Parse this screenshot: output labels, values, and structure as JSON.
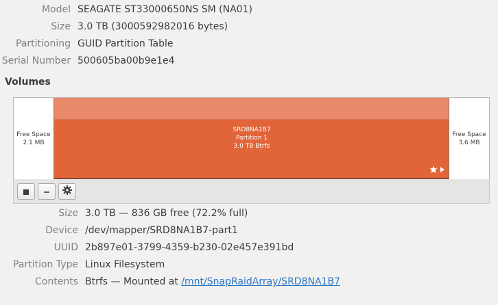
{
  "drive": {
    "model_label": "Model",
    "model_value": "SEAGATE ST33000650NS  SM (NA01)",
    "size_label": "Size",
    "size_value": "3.0 TB (3000592982016 bytes)",
    "partitioning_label": "Partitioning",
    "partitioning_value": "GUID Partition Table",
    "serial_label": "Serial Number",
    "serial_value": "500605ba00b9e1e4"
  },
  "volumes": {
    "title": "Volumes",
    "free_left": {
      "line1": "Free Space",
      "line2": "2.1 MB"
    },
    "free_right": {
      "line1": "Free Space",
      "line2": "3.6 MB"
    },
    "partition": {
      "name": "SRD8NA1B7",
      "number": "Partition 1",
      "summary": "3.0 TB Btrfs",
      "icons": [
        "star-icon",
        "play-icon"
      ]
    },
    "toolbar": {
      "buttons": [
        "stop-icon",
        "minus-icon",
        "gear-icon"
      ]
    }
  },
  "details": {
    "size_label": "Size",
    "size_value": "3.0 TB — 836 GB free (72.2% full)",
    "device_label": "Device",
    "device_value": "/dev/mapper/SRD8NA1B7-part1",
    "uuid_label": "UUID",
    "uuid_value": "2b897e01-3799-4359-b230-02e457e391bd",
    "ptype_label": "Partition Type",
    "ptype_value": "Linux Filesystem",
    "contents_label": "Contents",
    "contents_prefix": "Btrfs — Mounted at",
    "contents_link": "/mnt/SnapRaidArray/SRD8NA1B7"
  },
  "colors": {
    "partition_fill": "#e2653a",
    "container_fill": "#e8896a",
    "link": "#2a76c6",
    "label_gray": "#808080"
  }
}
